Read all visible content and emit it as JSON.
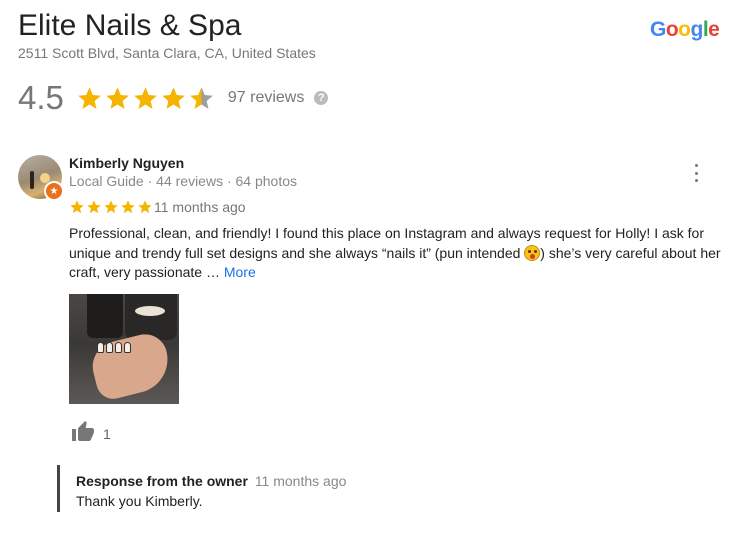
{
  "business": {
    "name": "Elite Nails & Spa",
    "address": "2511 Scott Blvd, Santa Clara, CA, United States",
    "rating": "4.5",
    "rating_value": 4.5,
    "reviews_count": "97 reviews",
    "help_symbol": "?"
  },
  "brand": {
    "logo_letters": [
      "G",
      "o",
      "o",
      "g",
      "l",
      "e"
    ],
    "logo_colors": [
      "#4285F4",
      "#EA4335",
      "#FBBC05",
      "#4285F4",
      "#34A853",
      "#EA4335"
    ]
  },
  "colors": {
    "star": "#f4b400",
    "star_empty": "#9e9e9e",
    "link": "#1a73e8",
    "local_guide_badge": "#e8711a"
  },
  "review": {
    "reviewer_name": "Kimberly Nguyen",
    "reviewer_meta": "Local Guide · 44 reviews · 64 photos",
    "stars": 5,
    "date": "11 months ago",
    "text_part1": "Professional, clean, and friendly! I found this place on Instagram and always request for Holly! I ask for unique and trendy full set designs and she always “nails it” (pun intended ",
    "emoji_name": "face-with-tongue-emoji",
    "text_part2": ") she’s very careful about her craft, very passionate … ",
    "more_label": "More",
    "like_count": "1",
    "icons": {
      "menu": "more-vert-icon",
      "like": "thumbs-up-icon",
      "badge": "local-guide-star-icon"
    }
  },
  "owner_response": {
    "title": "Response from the owner",
    "time": "11 months ago",
    "text": "Thank you Kimberly."
  }
}
